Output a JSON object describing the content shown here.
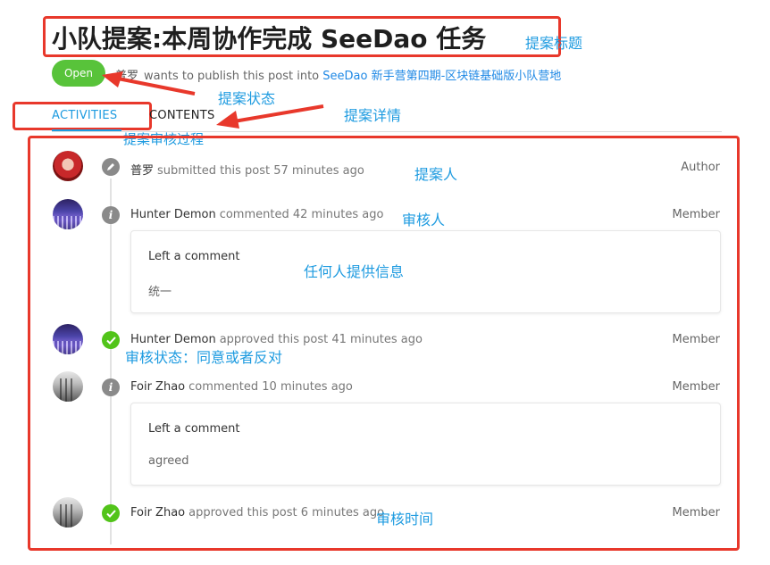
{
  "title": "小队提案:本周协作完成 SeeDao 任务",
  "status_badge": "Open",
  "publish": {
    "user": "普罗",
    "middle": "wants to publish this post into",
    "target": "SeeDao 新手营第四期-区块链基础版小队营地"
  },
  "tabs": [
    {
      "label": "ACTIVITIES"
    },
    {
      "label": "CONTENTS"
    }
  ],
  "annotations": {
    "title_note": "提案标题",
    "status_note": "提案状态",
    "details_note": "提案详情",
    "review_process_note": "提案审核过程",
    "proposer_note": "提案人",
    "reviewer_note": "审核人",
    "anyone_note": "任何人提供信息",
    "review_status_note": "审核状态：同意或者反对",
    "review_time_note": "审核时间"
  },
  "activities": [
    {
      "actor": "普罗",
      "action": "submitted this post 57 minutes ago",
      "role": "Author",
      "icon": "pencil-icon"
    },
    {
      "actor": "Hunter Demon",
      "action": "commented 42 minutes ago",
      "role": "Member",
      "icon": "info-icon",
      "comment": {
        "title": "Left a comment",
        "body": "统一"
      }
    },
    {
      "actor": "Hunter Demon",
      "action": "approved this post 41 minutes ago",
      "role": "Member",
      "icon": "check-icon"
    },
    {
      "actor": "Foir Zhao",
      "action": "commented 10 minutes ago",
      "role": "Member",
      "icon": "info-icon",
      "comment": {
        "title": "Left a comment",
        "body": "agreed"
      }
    },
    {
      "actor": "Foir Zhao",
      "action": "approved this post 6 minutes ago",
      "role": "Member",
      "icon": "check-icon"
    }
  ],
  "colors": {
    "annotation_red": "#e8382b",
    "annotation_blue": "#1e9be0",
    "open_green": "#58c33a",
    "approved_green": "#52c41a"
  }
}
